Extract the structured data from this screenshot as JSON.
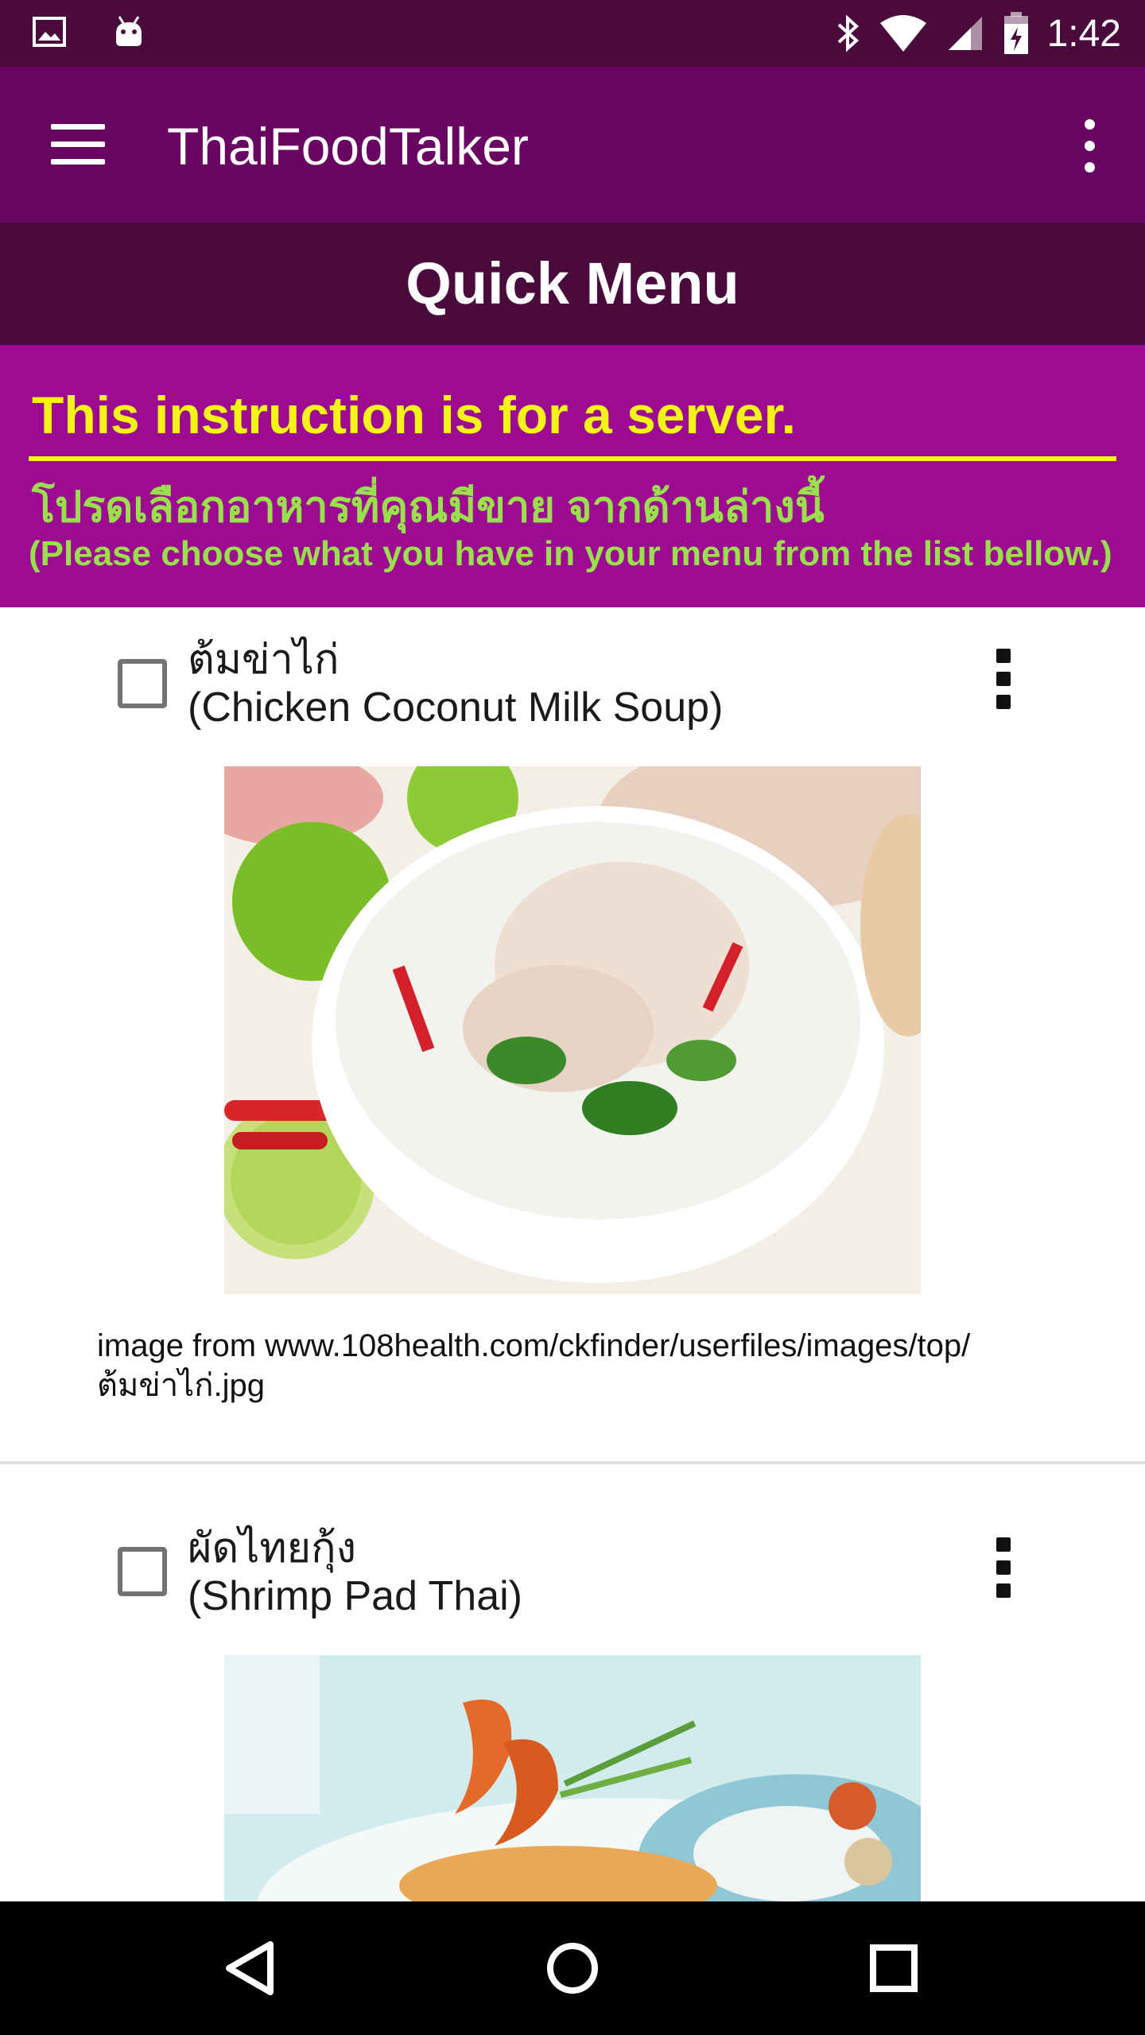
{
  "status_bar": {
    "time": "1:42",
    "icons": [
      "image-icon",
      "android-icon",
      "bluetooth-icon",
      "wifi-icon",
      "signal-icon",
      "battery-charging-icon"
    ]
  },
  "app_bar": {
    "title": "ThaiFoodTalker",
    "menu_icon": "hamburger-icon",
    "overflow_icon": "more-vert-icon"
  },
  "section": {
    "title": "Quick Menu"
  },
  "instruction": {
    "heading": "This instruction is for a server.",
    "thai_text": "โปรดเลือกอาหารที่คุณมีขาย จากด้านล่างนี้",
    "english_text": "(Please choose what you have in your menu from the list bellow.)"
  },
  "menu_items": [
    {
      "thai_name": "ต้มข่าไก่",
      "english_name": "(Chicken Coconut Milk Soup)",
      "checked": false,
      "image_credit": "image from www.108health.com/ckfinder/userfiles/images/top/ต้มข่าไก่.jpg"
    },
    {
      "thai_name": "ผัดไทยกุ้ง",
      "english_name": "(Shrimp Pad Thai)",
      "checked": false
    }
  ],
  "colors": {
    "status_bar": "#4a0a3c",
    "app_bar": "#690462",
    "section_bar": "#4a0a3c",
    "instruction_bg": "#9c0b91",
    "instruction_heading": "#f4f415",
    "instruction_text": "#9ae04c"
  },
  "navigation": {
    "back": "back-icon",
    "home": "home-icon",
    "recents": "recents-icon"
  }
}
